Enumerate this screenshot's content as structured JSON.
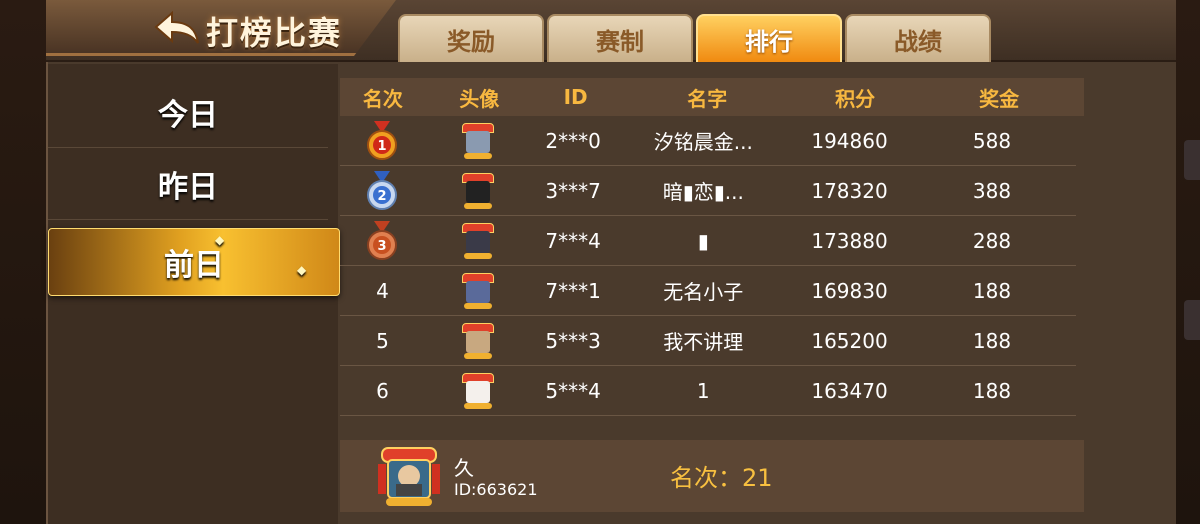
{
  "header": {
    "title": "打榜比赛",
    "back_icon": "back-arrow-icon"
  },
  "tabs": [
    {
      "label": "奖励",
      "active": false
    },
    {
      "label": "赛制",
      "active": false
    },
    {
      "label": "排行",
      "active": true
    },
    {
      "label": "战绩",
      "active": false
    }
  ],
  "sidebar": {
    "items": [
      {
        "label": "今日",
        "active": false
      },
      {
        "label": "昨日",
        "active": false
      },
      {
        "label": "前日",
        "active": true
      }
    ]
  },
  "table": {
    "headers": [
      "名次",
      "头像",
      "ID",
      "名字",
      "积分",
      "奖金"
    ],
    "rows": [
      {
        "rank": "1",
        "rank_icon": "gold-medal-icon",
        "id": "2***0",
        "name": "汐铭晨金...",
        "score": "194860",
        "prize": "588"
      },
      {
        "rank": "2",
        "rank_icon": "silver-medal-icon",
        "id": "3***7",
        "name": "暗▮恋▮...",
        "score": "178320",
        "prize": "388"
      },
      {
        "rank": "3",
        "rank_icon": "bronze-medal-icon",
        "id": "7***4",
        "name": "▮",
        "score": "173880",
        "prize": "288"
      },
      {
        "rank": "4",
        "rank_icon": "",
        "id": "7***1",
        "name": "无名小子",
        "score": "169830",
        "prize": "188"
      },
      {
        "rank": "5",
        "rank_icon": "",
        "id": "5***3",
        "name": "我不讲理",
        "score": "165200",
        "prize": "188"
      },
      {
        "rank": "6",
        "rank_icon": "",
        "id": "5***4",
        "name": "1",
        "score": "163470",
        "prize": "188"
      }
    ]
  },
  "me": {
    "name": "久",
    "id_text": "ID:663621",
    "rank_text": "名次：21"
  },
  "colors": {
    "accent_gold": "#f8b840",
    "tab_active": "#f08a10",
    "panel": "#4a3a2c"
  }
}
